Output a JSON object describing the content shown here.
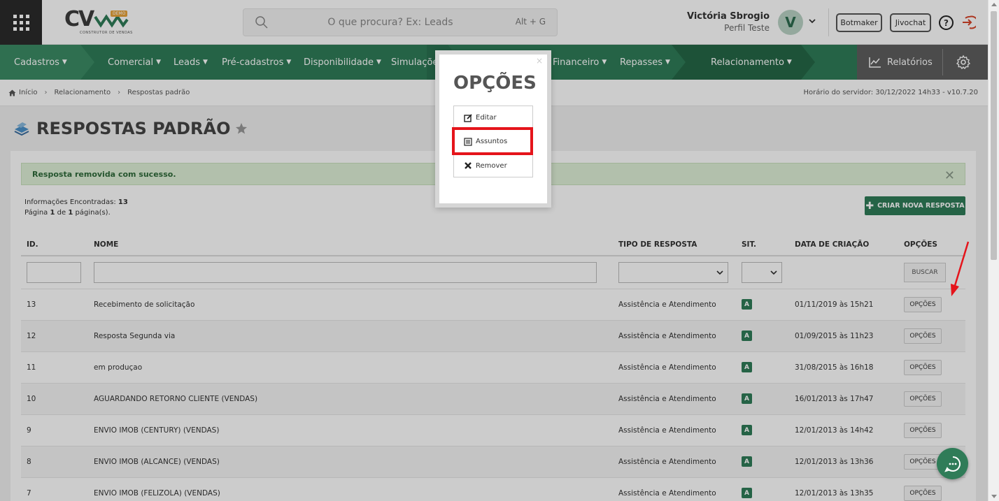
{
  "header": {
    "logo_text": "CV",
    "logo_badge": "DEMO",
    "logo_sub": "CONSTRUTOR DE VENDAS",
    "search_placeholder": "O que procura? Ex: Leads",
    "search_shortcut": "Alt + G",
    "user_name": "Victória Sbrogio",
    "user_profile": "Perfil Teste",
    "avatar_letter": "V",
    "botmaker_label": "Botmaker",
    "jivochat_label": "Jivochat",
    "help_label": "?"
  },
  "nav": {
    "items": [
      {
        "label": "Cadastros"
      },
      {
        "label": "Comercial"
      },
      {
        "label": "Leads"
      },
      {
        "label": "Pré-cadastros"
      },
      {
        "label": "Disponibilidade"
      },
      {
        "label": "Simulações"
      },
      {
        "label": "Financeiro"
      },
      {
        "label": "Repasses"
      },
      {
        "label": "Relacionamento"
      }
    ],
    "reports_label": "Relatórios"
  },
  "breadcrumb": {
    "items": [
      "Início",
      "Relacionamento",
      "Respostas padrão"
    ],
    "server_time": "Horário do servidor: 30/12/2022 14h33 - v10.7.20"
  },
  "page": {
    "title": "RESPOSTAS PADRÃO",
    "alert": "Resposta removida com sucesso.",
    "info_found_label": "Informações Encontradas:",
    "info_found_count": "13",
    "info_page_a": "Página",
    "info_page_num": "1",
    "info_page_b": "de",
    "info_page_total": "1",
    "info_page_c": "página(s).",
    "create_button": "CRIAR NOVA RESPOSTA"
  },
  "table": {
    "columns": [
      "ID.",
      "NOME",
      "TIPO DE RESPOSTA",
      "SIT.",
      "DATA DE CRIAÇÃO",
      "OPÇÕES"
    ],
    "search_button": "BUSCAR",
    "options_label": "OPÇÕES",
    "rows": [
      {
        "id": "13",
        "name": "Recebimento de solicitação",
        "type": "Assistência e Atendimento",
        "sit": "A",
        "date": "01/11/2019 às 15h21"
      },
      {
        "id": "12",
        "name": "Resposta Segunda via",
        "type": "Assistência e Atendimento",
        "sit": "A",
        "date": "01/09/2015 às 11h23"
      },
      {
        "id": "11",
        "name": "em produçao",
        "type": "Assistência e Atendimento",
        "sit": "A",
        "date": "31/08/2015 às 16h18"
      },
      {
        "id": "10",
        "name": "AGUARDANDO RETORNO CLIENTE (VENDAS)",
        "type": "Assistência e Atendimento",
        "sit": "A",
        "date": "16/01/2013 às 17h47"
      },
      {
        "id": "9",
        "name": "ENVIO IMOB (CENTURY) (VENDAS)",
        "type": "Assistência e Atendimento",
        "sit": "A",
        "date": "12/01/2013 às 14h42"
      },
      {
        "id": "8",
        "name": "ENVIO IMOB (ALCANCE) (VENDAS)",
        "type": "Assistência e Atendimento",
        "sit": "A",
        "date": "12/01/2013 às 13h36"
      },
      {
        "id": "7",
        "name": "ENVIO IMOB (FELIZOLA) (VENDAS)",
        "type": "Assistência e Atendimento",
        "sit": "A",
        "date": "12/01/2013 às 13h35"
      }
    ]
  },
  "modal": {
    "title": "OPÇÕES",
    "close": "×",
    "items": [
      "Editar",
      "Assuntos",
      "Remover"
    ]
  },
  "colors": {
    "brand_green": "#2f7c58",
    "highlight_red": "#e5141b"
  }
}
